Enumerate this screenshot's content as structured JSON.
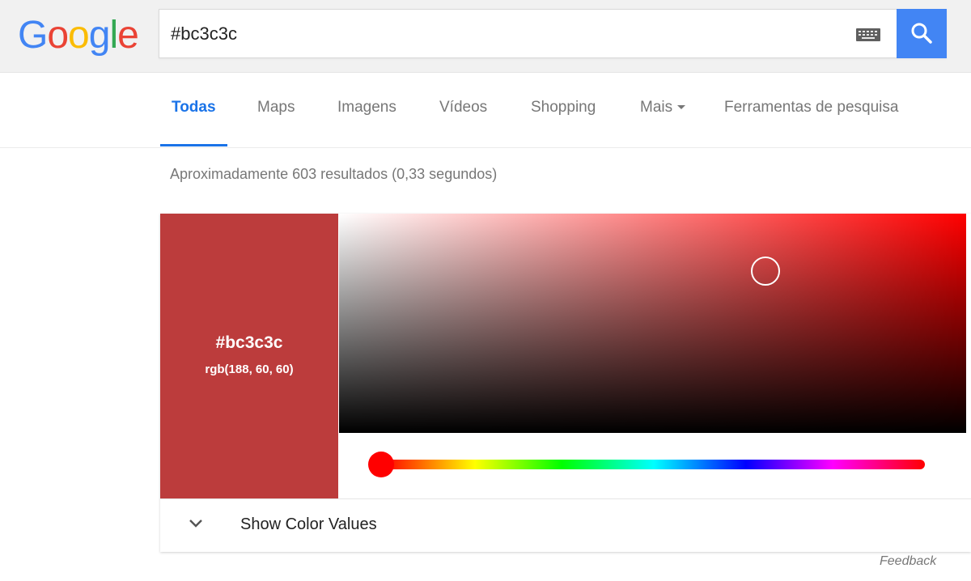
{
  "logo": {
    "letters": [
      "G",
      "o",
      "o",
      "g",
      "l",
      "e"
    ],
    "colors": [
      "#4285f4",
      "#ea4335",
      "#fbbc05",
      "#4285f4",
      "#34a853",
      "#ea4335"
    ]
  },
  "search": {
    "query": "#bc3c3c"
  },
  "tabs": [
    {
      "label": "Todas",
      "active": true
    },
    {
      "label": "Maps"
    },
    {
      "label": "Imagens"
    },
    {
      "label": "Vídeos"
    },
    {
      "label": "Shopping"
    },
    {
      "label": "Mais"
    },
    {
      "label": "Ferramentas de pesquisa"
    }
  ],
  "result_stats": "Aproximadamente 603 resultados (0,33 segundos)",
  "color_picker": {
    "hex": "#bc3c3c",
    "rgb": "rgb(188, 60, 60)",
    "saturation": 0.68,
    "value": 0.737,
    "hue": 0,
    "show_values_label": "Show Color Values"
  },
  "feedback_label": "Feedback",
  "colors": {
    "accent": "#4285f4",
    "active_tab": "#1a73e8",
    "swatch": "#bc3c3c"
  },
  "icons": [
    "keyboard-icon",
    "search-icon",
    "caret-down-icon",
    "chevron-down-icon"
  ]
}
